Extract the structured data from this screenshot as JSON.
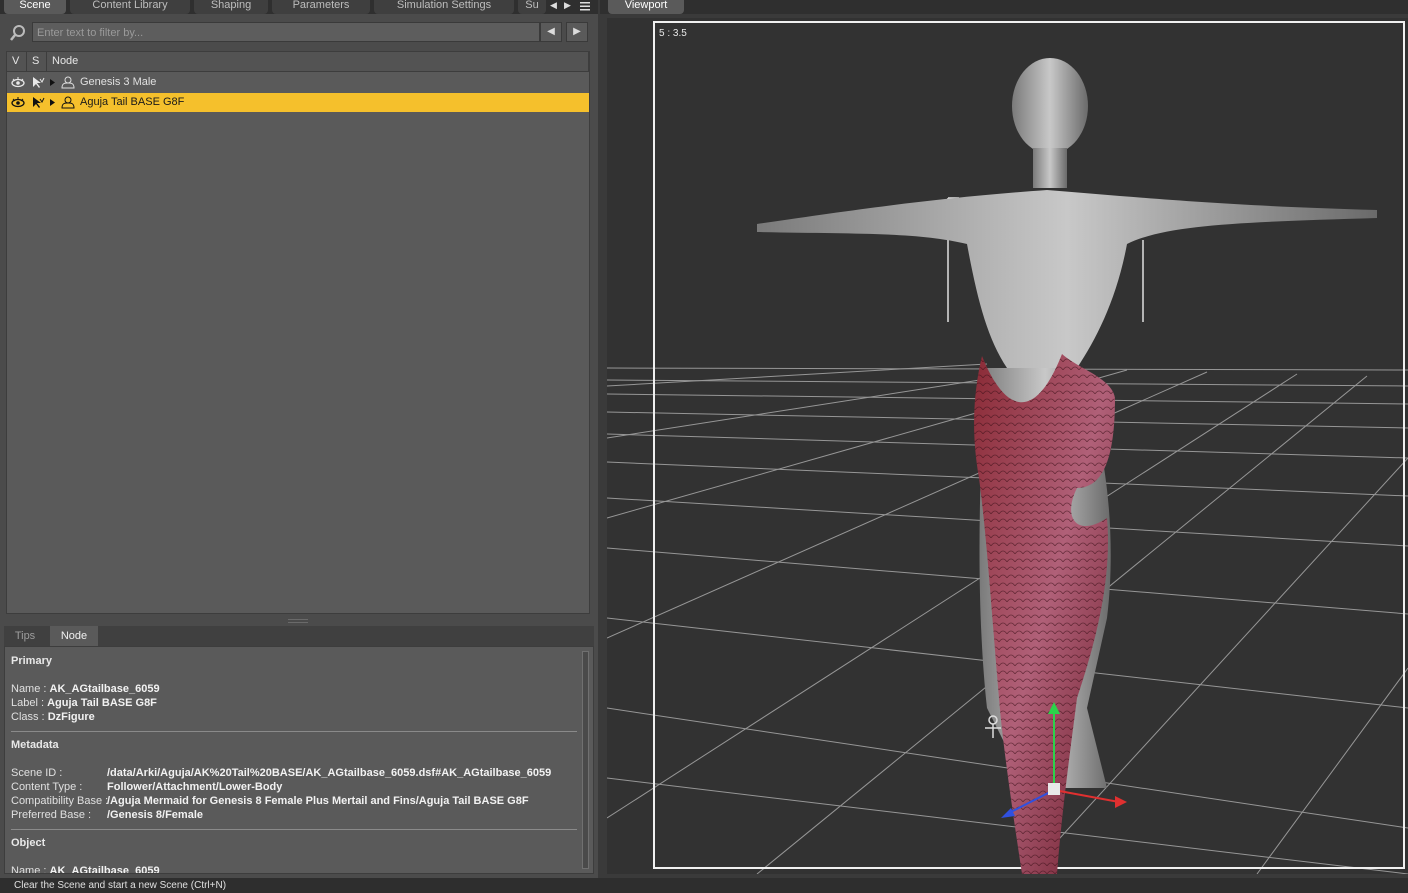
{
  "left_tabs": [
    "Scene",
    "Content Library",
    "Shaping",
    "Parameters",
    "Simulation Settings",
    "Su"
  ],
  "search": {
    "placeholder": "Enter text to filter by..."
  },
  "tree": {
    "columns": [
      "V",
      "S",
      "Node"
    ],
    "rows": [
      {
        "label": "Genesis 3 Male",
        "selected": false
      },
      {
        "label": "Aguja Tail BASE G8F",
        "selected": true
      }
    ]
  },
  "info_tabs": [
    "Tips",
    "Node"
  ],
  "info": {
    "primary_title": "Primary",
    "name_key": "Name :",
    "name_val": "AK_AGtailbase_6059",
    "label_key": "Label :",
    "label_val": "Aguja Tail BASE G8F",
    "class_key": "Class :",
    "class_val": "DzFigure",
    "metadata_title": "Metadata",
    "scene_id_key": "Scene ID :",
    "scene_id_val": "/data/Arki/Aguja/AK%20Tail%20BASE/AK_AGtailbase_6059.dsf#AK_AGtailbase_6059",
    "content_type_key": "Content Type :",
    "content_type_val": "Follower/Attachment/Lower-Body",
    "compat_key": "Compatibility Base :",
    "compat_val": "/Aguja Mermaid for Genesis 8 Female Plus Mertail and Fins/Aguja Tail BASE G8F",
    "preferred_key": "Preferred Base :",
    "preferred_val": "/Genesis 8/Female",
    "object_title": "Object",
    "obj_name_key": "Name :",
    "obj_name_val": "AK_AGtailbase_6059"
  },
  "viewport": {
    "tab": "Viewport",
    "aspect": "5 : 3.5"
  },
  "status": "Clear the Scene and start a new Scene (Ctrl+N)",
  "colors": {
    "selection": "#f5c02c",
    "panel": "#5a5a5a",
    "viewport_bg": "#323232"
  },
  "icons": [
    "search-icon",
    "arrow-left-icon",
    "arrow-right-icon",
    "eye-icon",
    "pointer-icon",
    "expand-arrow-icon",
    "figure-icon",
    "menu-icon",
    "gizmo-icon",
    "universal-tool-icon"
  ]
}
